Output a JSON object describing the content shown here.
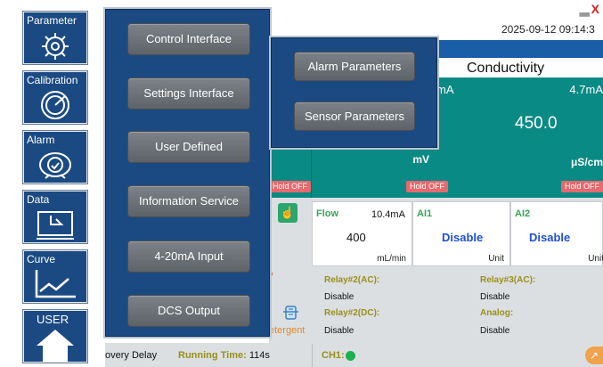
{
  "window": {
    "minimize_icon": "minimize-icon",
    "close_label": "X"
  },
  "header": {
    "datetime": "2025-09-12 09:14:3"
  },
  "left_nav": [
    {
      "label": "Parameter",
      "icon": "gear-icon"
    },
    {
      "label": "Calibration",
      "icon": "gauge-icon"
    },
    {
      "label": "Alarm",
      "icon": "alarm-icon"
    },
    {
      "label": "Data",
      "icon": "data-icon"
    },
    {
      "label": "Curve",
      "icon": "curve-icon"
    },
    {
      "label": "USER",
      "icon": "home-icon"
    }
  ],
  "submenu": {
    "items": [
      "Control Interface",
      "Settings Interface",
      "User Defined",
      "Information Service",
      "4-20mA Input",
      "DCS Output"
    ]
  },
  "submenu2": {
    "items": [
      "Alarm Parameters",
      "Sensor Parameters"
    ]
  },
  "conductivity": {
    "title": "Conductivity",
    "ma": "4.7mA",
    "value": "450.0",
    "unit": "μS/cm",
    "hold": "Hold OFF"
  },
  "mid_panel": {
    "ma": "mA",
    "unit": "mV",
    "hold": "Hold OFF"
  },
  "left_panel": {
    "hold": "Hold OFF"
  },
  "flow": {
    "title": "Flow",
    "ma": "10.4mA",
    "value": "400",
    "unit": "mL/min"
  },
  "ai1": {
    "title": "AI1",
    "value": "Disable",
    "unit": "Unit"
  },
  "ai2": {
    "title": "AI2",
    "value": "Disable",
    "unit": "Unit"
  },
  "relays": {
    "relay2_ac_label": "Relay#2(AC):",
    "relay2_ac_value": "Disable",
    "relay3_ac_label": "Relay#3(AC):",
    "relay3_ac_value": "Disable",
    "relay2_dc_label": "Relay#2(DC):",
    "relay2_dc_value": "Disable",
    "analog_label": "Analog:",
    "analog_value": "Disable"
  },
  "fragments": {
    "red_text": "y",
    "detergent": "etergent"
  },
  "status": {
    "recovery": "overy Delay",
    "running_label": "Running Time:",
    "running_value": "114s",
    "ch1": "CH1:"
  },
  "colors": {
    "nav_blue": "#1b4a83",
    "teal": "#0a8a84",
    "hold_red": "#e7696e",
    "label_olive": "#98901b",
    "status_green": "#1db14d",
    "link_blue": "#1f4fd6"
  }
}
